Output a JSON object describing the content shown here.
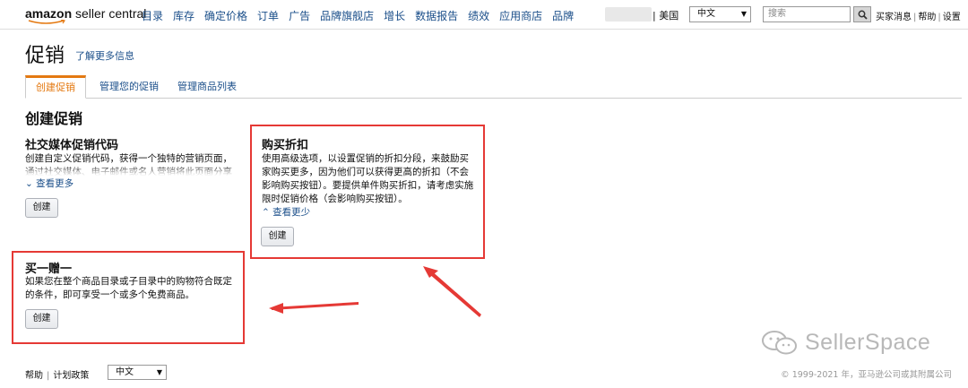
{
  "header": {
    "logo_brand": "amazon",
    "logo_suffix": "seller central",
    "nav_items": [
      "目录",
      "库存",
      "确定价格",
      "订单",
      "广告",
      "品牌旗舰店",
      "增长",
      "数据报告",
      "绩效",
      "应用商店",
      "品牌"
    ],
    "marketplace": "| 美国",
    "language": "中文",
    "search_placeholder": "搜索",
    "links": [
      "买家消息",
      "帮助",
      "设置"
    ]
  },
  "page": {
    "title": "促销",
    "learn_more": "了解更多信息"
  },
  "tabs": [
    "创建促销",
    "管理您的促销",
    "管理商品列表"
  ],
  "section_title": "创建促销",
  "cards": {
    "social": {
      "title": "社交媒体促销代码",
      "desc": "创建自定义促销代码，获得一个独特的营销页面，通过社交媒体、电子邮件或名人营销将此页面分享给买家。",
      "toggle": "查看更多",
      "button": "创建"
    },
    "tiered": {
      "title": "购买折扣",
      "desc": "使用高级选项，以设置促销的折扣分段，来鼓励买家购买更多，因为他们可以获得更高的折扣（不会影响购买按钮）。要提供单件购买折扣，请考虑实施限时促销价格（会影响购买按钮）。",
      "toggle": "查看更少",
      "button": "创建"
    },
    "bogo": {
      "title": "买一赠一",
      "desc": "如果您在整个商品目录或子目录中的购物符合既定的条件，即可享受一个或多个免费商品。",
      "button": "创建"
    }
  },
  "footer": {
    "links": [
      "帮助",
      "计划政策"
    ],
    "language": "中文",
    "copyright": "© 1999-2021 年，亚马逊公司或其附属公司"
  },
  "watermark": "SellerSpace",
  "colors": {
    "accent": "#e47911",
    "link": "#1b4f8a",
    "annotation": "#e53935"
  }
}
